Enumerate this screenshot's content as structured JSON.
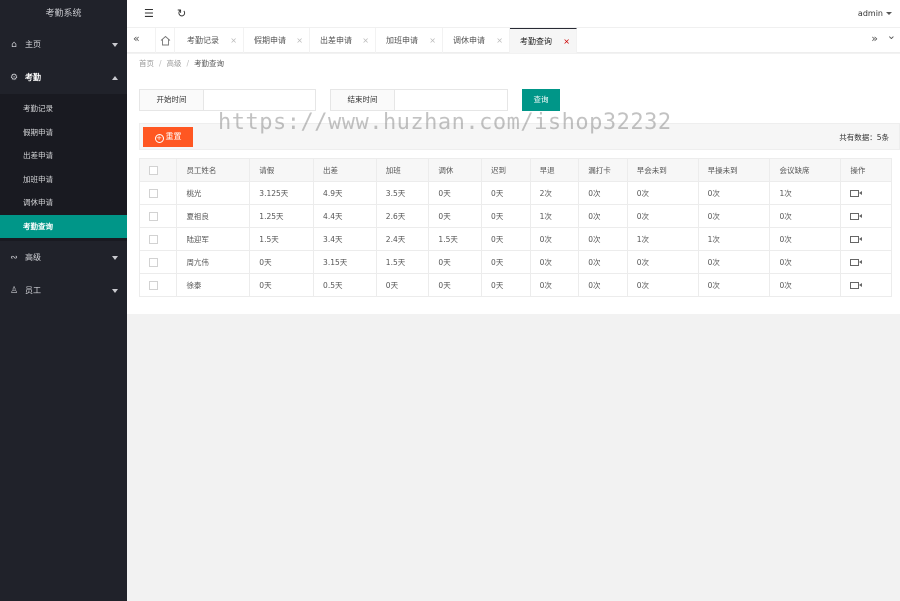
{
  "app": {
    "title": "考勤系统"
  },
  "header": {
    "menu_icon": "☰",
    "refresh_icon": "↻",
    "user": "admin"
  },
  "sidebar": {
    "items": [
      {
        "label": "主页",
        "icon": "⌂"
      },
      {
        "label": "考勤",
        "icon": "⚙"
      },
      {
        "label": "高级",
        "icon": "∾"
      },
      {
        "label": "员工",
        "icon": "♙"
      }
    ],
    "submenu": [
      "考勤记录",
      "假期申请",
      "出差申请",
      "加班申请",
      "调休申请",
      "考勤查询"
    ]
  },
  "tabs": {
    "items": [
      "考勤记录",
      "假期申请",
      "出差申请",
      "加班申请",
      "调休申请",
      "考勤查询"
    ],
    "close": "×",
    "left_arrow": "«",
    "right_arrow": "»",
    "down_arrow": "⌄"
  },
  "breadcrumb": [
    "首页",
    "高级",
    "考勤查询"
  ],
  "filters": {
    "start_label": "开始时间",
    "start_value": "",
    "end_label": "结束时间",
    "end_value": "",
    "search_button": "查询"
  },
  "toolbar": {
    "reset_button": "重置",
    "total_text": "共有数据：5条"
  },
  "table": {
    "headers": [
      "员工姓名",
      "请假",
      "出差",
      "加班",
      "调休",
      "迟到",
      "早退",
      "漏打卡",
      "早会未到",
      "早操未到",
      "会议缺席",
      "操作"
    ],
    "rows": [
      [
        "桃光",
        "3.125天",
        "4.9天",
        "3.5天",
        "0天",
        "0天",
        "2次",
        "0次",
        "0次",
        "0次",
        "1次"
      ],
      [
        "夏祖良",
        "1.25天",
        "4.4天",
        "2.6天",
        "0天",
        "0天",
        "1次",
        "0次",
        "0次",
        "0次",
        "0次"
      ],
      [
        "陆迎军",
        "1.5天",
        "3.4天",
        "2.4天",
        "1.5天",
        "0天",
        "0次",
        "0次",
        "1次",
        "1次",
        "0次"
      ],
      [
        "周亢伟",
        "0天",
        "3.15天",
        "1.5天",
        "0天",
        "0天",
        "0次",
        "0次",
        "0次",
        "0次",
        "0次"
      ],
      [
        "徐泰",
        "0天",
        "0.5天",
        "0天",
        "0天",
        "0天",
        "0次",
        "0次",
        "0次",
        "0次",
        "0次"
      ]
    ]
  },
  "watermark": "https://www.huzhan.com/ishop32232",
  "colors": {
    "sidebar_bg": "#20222a",
    "accent": "#009688",
    "reset": "#ff5722"
  }
}
